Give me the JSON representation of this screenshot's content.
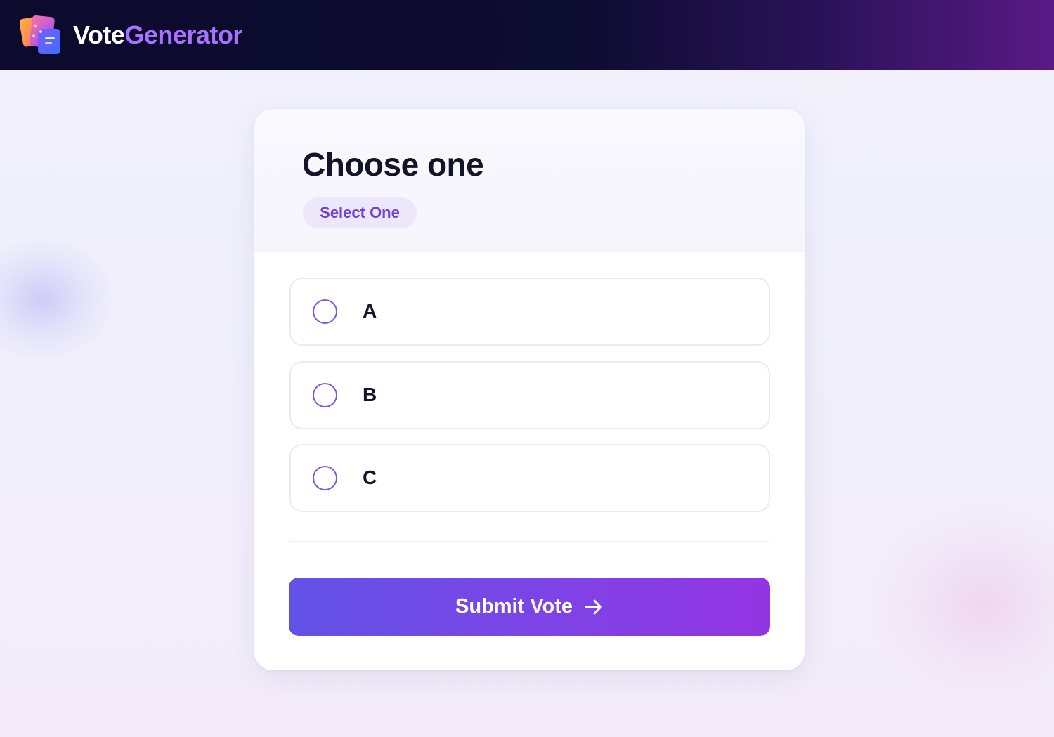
{
  "header": {
    "logo_icon": "cards-logo-icon",
    "brand_part1": "Vote",
    "brand_part2": "Generator"
  },
  "poll": {
    "title": "Choose one",
    "badge": "Select One",
    "options": [
      {
        "label": "A",
        "selected": false
      },
      {
        "label": "B",
        "selected": false
      },
      {
        "label": "C",
        "selected": false
      }
    ],
    "submit_label": "Submit Vote",
    "submit_icon": "arrow-right-icon"
  },
  "colors": {
    "accent": "#7b56e8",
    "brand_purple": "#a872ff",
    "header_dark": "#0c0b2e",
    "button_start": "#6152e6",
    "button_end": "#9334e2"
  }
}
